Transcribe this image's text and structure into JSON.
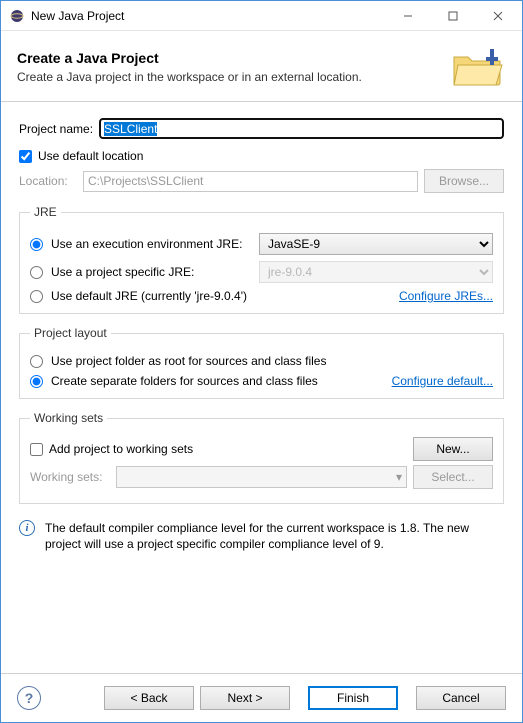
{
  "window": {
    "title": "New Java Project"
  },
  "header": {
    "title": "Create a Java Project",
    "desc": "Create a Java project in the workspace or in an external location."
  },
  "projectName": {
    "label": "Project name:",
    "value": "SSLClient"
  },
  "useDefaultLocation": {
    "label": "Use default location",
    "checked": true
  },
  "location": {
    "label": "Location:",
    "value": "C:\\Projects\\SSLClient",
    "browse": "Browse..."
  },
  "jre": {
    "legend": "JRE",
    "opt1": "Use an execution environment JRE:",
    "opt1_value": "JavaSE-9",
    "opt2": "Use a project specific JRE:",
    "opt2_value": "jre-9.0.4",
    "opt3": "Use default JRE (currently 'jre-9.0.4')",
    "configure": "Configure JREs..."
  },
  "layout": {
    "legend": "Project layout",
    "opt1": "Use project folder as root for sources and class files",
    "opt2": "Create separate folders for sources and class files",
    "configure": "Configure default..."
  },
  "workingSets": {
    "legend": "Working sets",
    "addLabel": "Add project to working sets",
    "newBtn": "New...",
    "wsLabel": "Working sets:",
    "selectBtn": "Select..."
  },
  "info": {
    "text": "The default compiler compliance level for the current workspace is 1.8. The new project will use a project specific compiler compliance level of 9."
  },
  "footer": {
    "back": "< Back",
    "next": "Next >",
    "finish": "Finish",
    "cancel": "Cancel"
  }
}
